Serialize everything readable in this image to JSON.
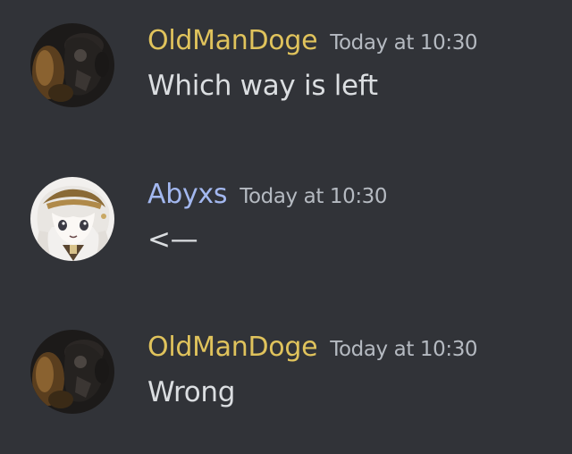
{
  "colors": {
    "background": "#313338",
    "timestamp": "#b5bac1",
    "message_text": "#dbdee1"
  },
  "messages": [
    {
      "username": "OldManDoge",
      "username_color": "#e0c35c",
      "timestamp": "Today at 10:30",
      "content": "Which way is left",
      "avatar_icon": "doge-avatar-icon"
    },
    {
      "username": "Abyxs",
      "username_color": "#a3b8f0",
      "timestamp": "Today at 10:30",
      "content": "<—",
      "avatar_icon": "anime-girl-avatar-icon"
    },
    {
      "username": "OldManDoge",
      "username_color": "#e0c35c",
      "timestamp": "Today at 10:30",
      "content": "Wrong",
      "avatar_icon": "doge-avatar-icon"
    }
  ]
}
